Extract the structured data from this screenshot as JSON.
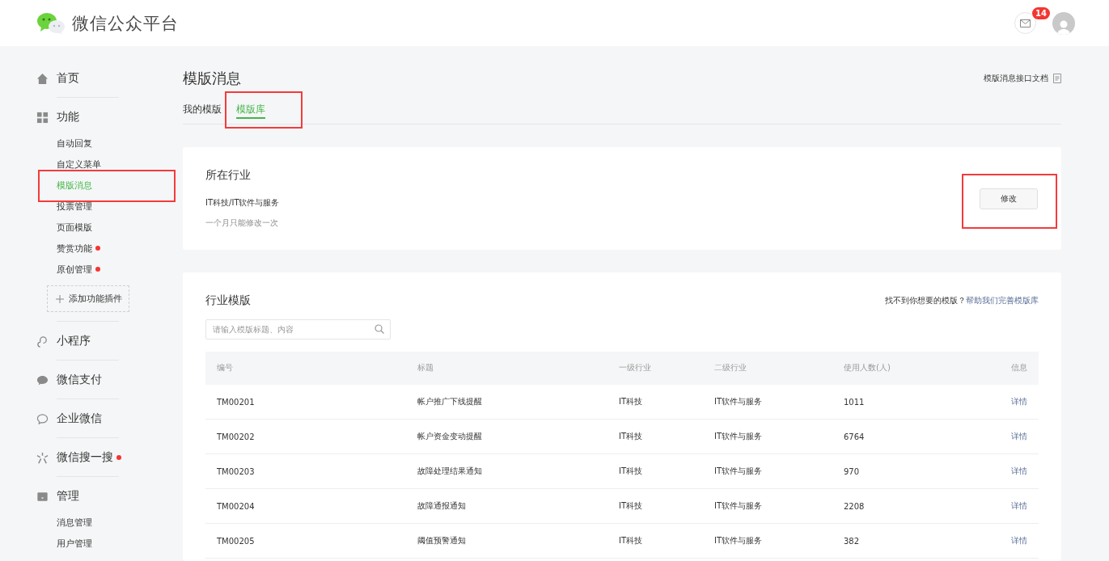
{
  "header": {
    "title": "微信公众平台",
    "mail_badge": "14"
  },
  "sidebar": {
    "groups": [
      {
        "kind": "home",
        "label": "首页",
        "dot": false
      },
      {
        "kind": "grid",
        "label": "功能",
        "dot": false,
        "children": [
          {
            "label": "自动回复",
            "selected": false,
            "dot": false,
            "highlighted": false
          },
          {
            "label": "自定义菜单",
            "selected": false,
            "dot": false,
            "highlighted": false
          },
          {
            "label": "模版消息",
            "selected": true,
            "dot": false,
            "highlighted": true
          },
          {
            "label": "投票管理",
            "selected": false,
            "dot": false,
            "highlighted": false
          },
          {
            "label": "页面模版",
            "selected": false,
            "dot": false,
            "highlighted": false
          },
          {
            "label": "赞赏功能",
            "selected": false,
            "dot": true,
            "highlighted": false
          },
          {
            "label": "原创管理",
            "selected": false,
            "dot": true,
            "highlighted": false
          }
        ],
        "add_button": "添加功能插件"
      },
      {
        "kind": "miniapp",
        "label": "小程序",
        "dot": false
      },
      {
        "kind": "pay",
        "label": "微信支付",
        "dot": false
      },
      {
        "kind": "work",
        "label": "企业微信",
        "dot": false
      },
      {
        "kind": "search",
        "label": "微信搜一搜",
        "dot": true
      },
      {
        "kind": "manage",
        "label": "管理",
        "dot": false,
        "children": [
          {
            "label": "消息管理",
            "selected": false,
            "dot": false,
            "highlighted": false
          },
          {
            "label": "用户管理",
            "selected": false,
            "dot": false,
            "highlighted": false
          }
        ]
      }
    ]
  },
  "page": {
    "title": "模版消息",
    "doc_link": "模版消息接口文档",
    "tabs": [
      {
        "label": "我的模版",
        "selected": false,
        "highlighted": false
      },
      {
        "label": "模版库",
        "selected": true,
        "highlighted": true
      }
    ]
  },
  "industry_card": {
    "title": "所在行业",
    "industry": "IT科技/IT软件与服务",
    "note": "一个月只能修改一次",
    "button": {
      "label": "修改",
      "highlighted": true
    }
  },
  "template_card": {
    "title": "行业模版",
    "hint": "找不到你想要的模版？",
    "hint_link": "帮助我们完善模版库",
    "search": {
      "placeholder": "请输入模版标题、内容"
    },
    "table": {
      "columns": [
        "编号",
        "标题",
        "一级行业",
        "二级行业",
        "使用人数(人)",
        "信息"
      ],
      "rows": [
        [
          "TM00201",
          "帐户推广下线提醒",
          "IT科技",
          "IT软件与服务",
          "1011",
          "详情"
        ],
        [
          "TM00202",
          "帐户资金变动提醒",
          "IT科技",
          "IT软件与服务",
          "6764",
          "详情"
        ],
        [
          "TM00203",
          "故障处理结果通知",
          "IT科技",
          "IT软件与服务",
          "970",
          "详情"
        ],
        [
          "TM00204",
          "故障通报通知",
          "IT科技",
          "IT软件与服务",
          "2208",
          "详情"
        ],
        [
          "TM00205",
          "阈值预警通知",
          "IT科技",
          "IT软件与服务",
          "382",
          "详情"
        ]
      ]
    }
  }
}
